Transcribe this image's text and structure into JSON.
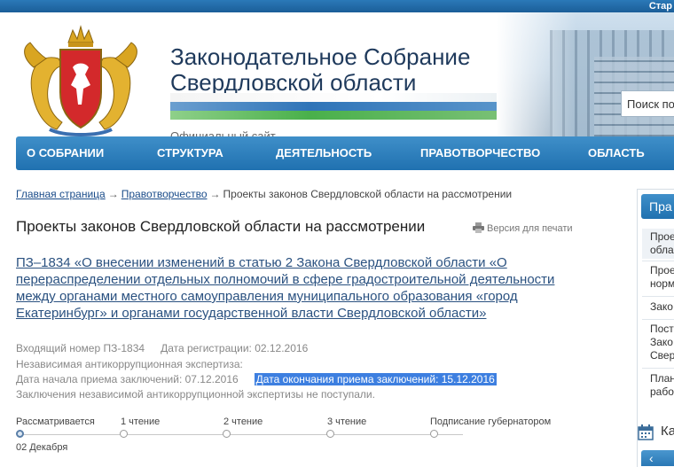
{
  "topbar": {
    "link": "Стар"
  },
  "header": {
    "title_line1": "Законодательное Собрание",
    "title_line2": "Свердловской области",
    "subtitle": "Официальный сайт",
    "search_placeholder": "Поиск по"
  },
  "nav": [
    {
      "label": "О собрании"
    },
    {
      "label": "Структура"
    },
    {
      "label": "Деятельность"
    },
    {
      "label": "Правотворчество"
    },
    {
      "label": "Область"
    }
  ],
  "breadcrumb": {
    "home": "Главная страница",
    "section": "Правотворчество",
    "current": "Проекты законов Свердловской области на рассмотрении",
    "separator": "→"
  },
  "page": {
    "title": "Проекты законов Свердловской области на рассмотрении",
    "print_label": "Версия для печати"
  },
  "bill": {
    "title": "ПЗ–1834 «О внесении изменений в статью 2 Закона Свердловской области «О перераспределении отдельных полномочий в сфере градостроительной деятельности между органами местного самоуправления муниципального образования «город Екатеринбург» и органами государственной власти Свердловской области»",
    "incoming_number": "Входящий номер ПЗ-1834",
    "registration_date": "Дата регистрации: 02.12.2016",
    "expertise": "Независимая антикоррупционная экспертиза:",
    "start_date": "Дата начала приема заключений: 07.12.2016",
    "end_date": "Дата окончания приема заключений: 15.12.2016",
    "conclusions": "Заключения независимой антикоррупционной экспертизы не поступали."
  },
  "timeline": {
    "stages": [
      {
        "label": "Рассматривается",
        "active": true
      },
      {
        "label": "1 чтение",
        "active": false
      },
      {
        "label": "2 чтение",
        "active": false
      },
      {
        "label": "3 чтение",
        "active": false
      },
      {
        "label": "Подписание губернатором",
        "active": false
      }
    ],
    "date": "02 Декабря"
  },
  "sidebar": {
    "header": "Пра",
    "items": [
      {
        "lines": [
          "Прое",
          "обла"
        ],
        "selected": true
      },
      {
        "lines": [
          "Прое",
          "норм"
        ],
        "selected": false
      },
      {
        "lines": [
          "Зако"
        ],
        "selected": false
      },
      {
        "lines": [
          "Пост",
          "Зако",
          "Свер"
        ],
        "selected": false
      },
      {
        "lines": [
          "План",
          "рабо"
        ],
        "selected": false
      }
    ],
    "calendar_label": "Ка",
    "button_label": "‹"
  },
  "colors": {
    "nav_blue": "#2071b0",
    "link": "#1a4c8a",
    "highlight": "#3d7fe0",
    "flag_blue": "#2f74b8",
    "flag_green": "#49b04a"
  }
}
